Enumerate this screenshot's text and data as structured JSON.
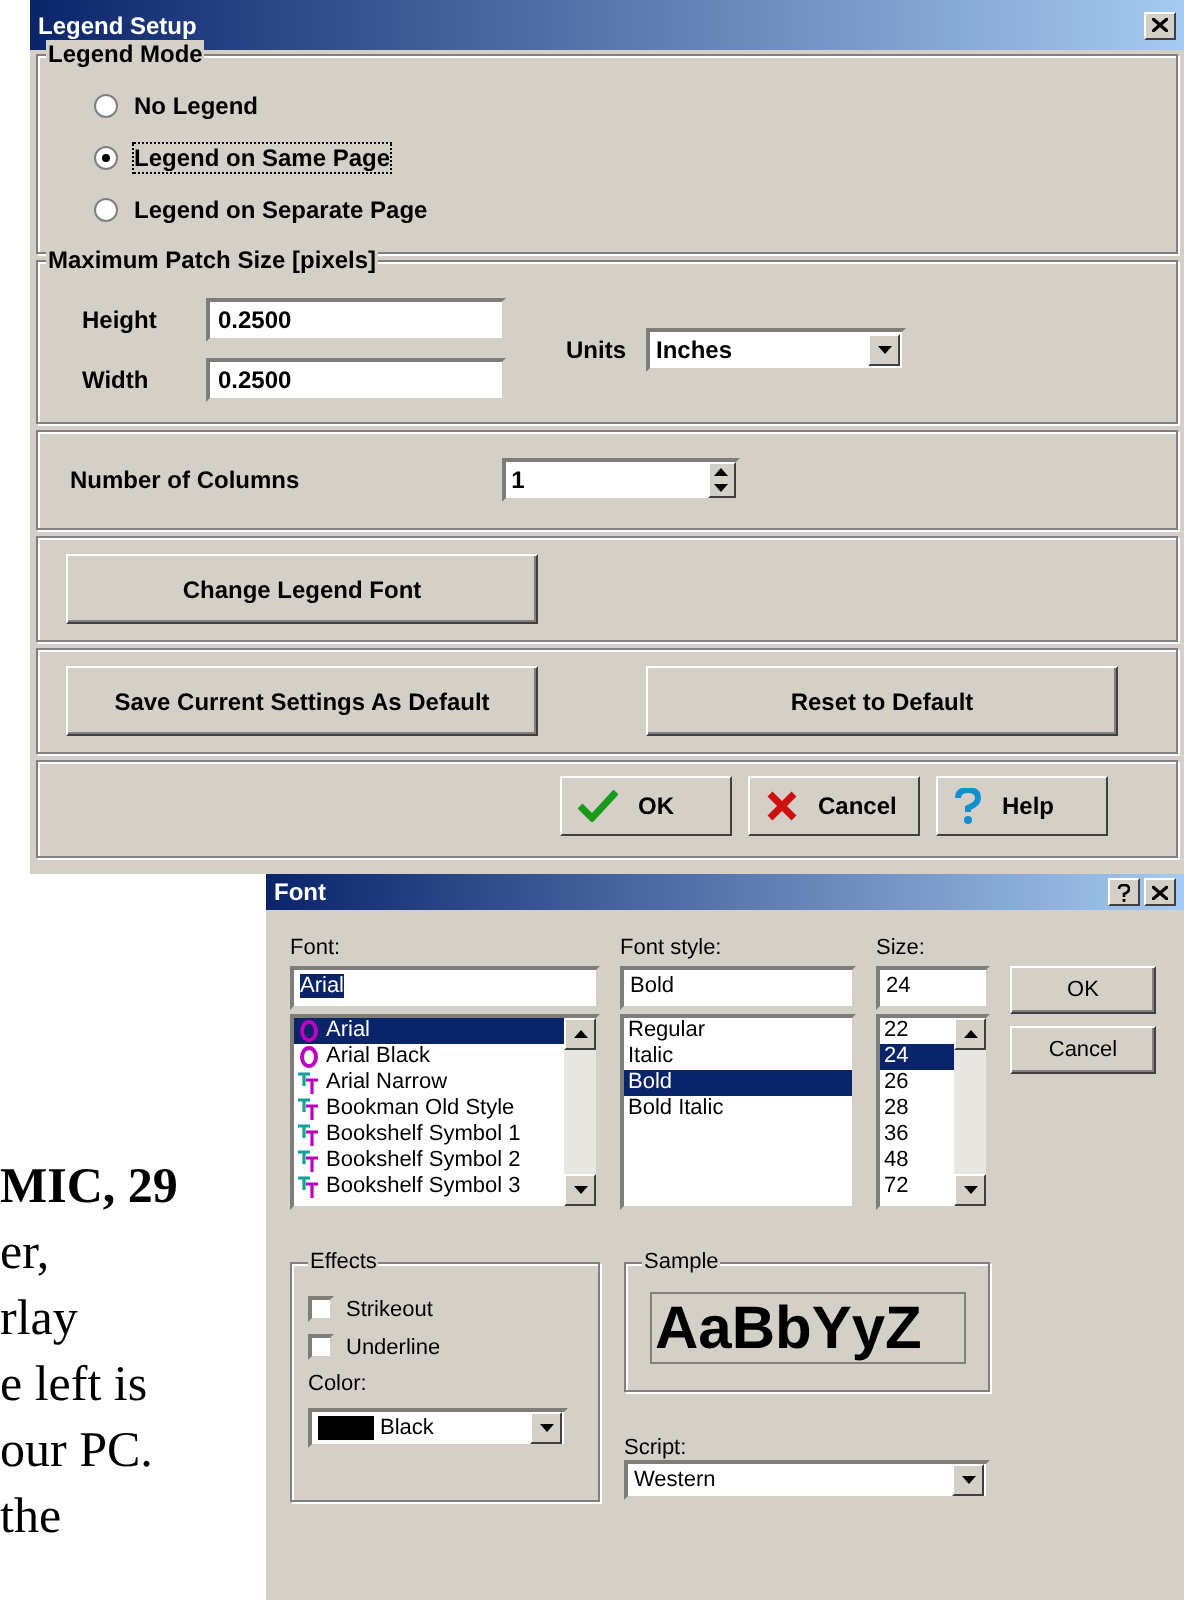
{
  "legend_dialog": {
    "title": "Legend Setup",
    "legend_mode": {
      "label": "Legend Mode",
      "options": [
        {
          "label": "No Legend",
          "selected": false
        },
        {
          "label": "Legend on Same Page",
          "selected": true
        },
        {
          "label": "Legend on Separate Page",
          "selected": false
        }
      ]
    },
    "patch_size": {
      "label": "Maximum Patch Size [pixels]",
      "height": {
        "label": "Height",
        "value": "0.2500"
      },
      "width": {
        "label": "Width",
        "value": "0.2500"
      },
      "units": {
        "label": "Units",
        "value": "Inches"
      }
    },
    "columns": {
      "label": "Number of Columns",
      "value": "1"
    },
    "change_font_button": "Change Legend Font",
    "save_default_button": "Save Current Settings As Default",
    "reset_button": "Reset to Default",
    "footer_buttons": [
      {
        "kind": "ok",
        "label": "OK"
      },
      {
        "kind": "cancel",
        "label": "Cancel"
      },
      {
        "kind": "help",
        "label": "Help"
      }
    ]
  },
  "document": {
    "heading": "MIC, 29",
    "paragraphs": [
      {
        "lines": [
          "er,",
          "rlay",
          "e left is",
          "our PC."
        ]
      },
      {
        "lines": [
          "the"
        ]
      }
    ]
  },
  "font_dialog": {
    "title": "Font",
    "font": {
      "label": "Font:",
      "value": "Arial",
      "items": [
        {
          "label": "Arial",
          "kind": "opentype",
          "selected": true
        },
        {
          "label": "Arial Black",
          "kind": "opentype",
          "selected": false
        },
        {
          "label": "Arial Narrow",
          "kind": "truetype",
          "selected": false
        },
        {
          "label": "Bookman Old Style",
          "kind": "truetype",
          "selected": false
        },
        {
          "label": "Bookshelf Symbol 1",
          "kind": "truetype",
          "selected": false
        },
        {
          "label": "Bookshelf Symbol 2",
          "kind": "truetype",
          "selected": false
        },
        {
          "label": "Bookshelf Symbol 3",
          "kind": "truetype",
          "selected": false
        }
      ]
    },
    "style": {
      "label": "Font style:",
      "value": "Bold",
      "items": [
        {
          "label": "Regular",
          "selected": false
        },
        {
          "label": "Italic",
          "selected": false
        },
        {
          "label": "Bold",
          "selected": true
        },
        {
          "label": "Bold Italic",
          "selected": false
        }
      ]
    },
    "size": {
      "label": "Size:",
      "value": "24",
      "items": [
        {
          "label": "22",
          "selected": false
        },
        {
          "label": "24",
          "selected": true
        },
        {
          "label": "26",
          "selected": false
        },
        {
          "label": "28",
          "selected": false
        },
        {
          "label": "36",
          "selected": false
        },
        {
          "label": "48",
          "selected": false
        },
        {
          "label": "72",
          "selected": false
        }
      ]
    },
    "buttons": [
      "OK",
      "Cancel"
    ],
    "effects": {
      "label": "Effects",
      "checkboxes": [
        {
          "label": "Strikeout",
          "checked": false
        },
        {
          "label": "Underline",
          "checked": false
        }
      ],
      "color_label": "Color:",
      "color": {
        "label": "Black",
        "color": "#000000"
      }
    },
    "sample": {
      "label": "Sample",
      "text": "AaBbYyZ"
    },
    "script": {
      "label": "Script:",
      "value": "Western"
    }
  }
}
